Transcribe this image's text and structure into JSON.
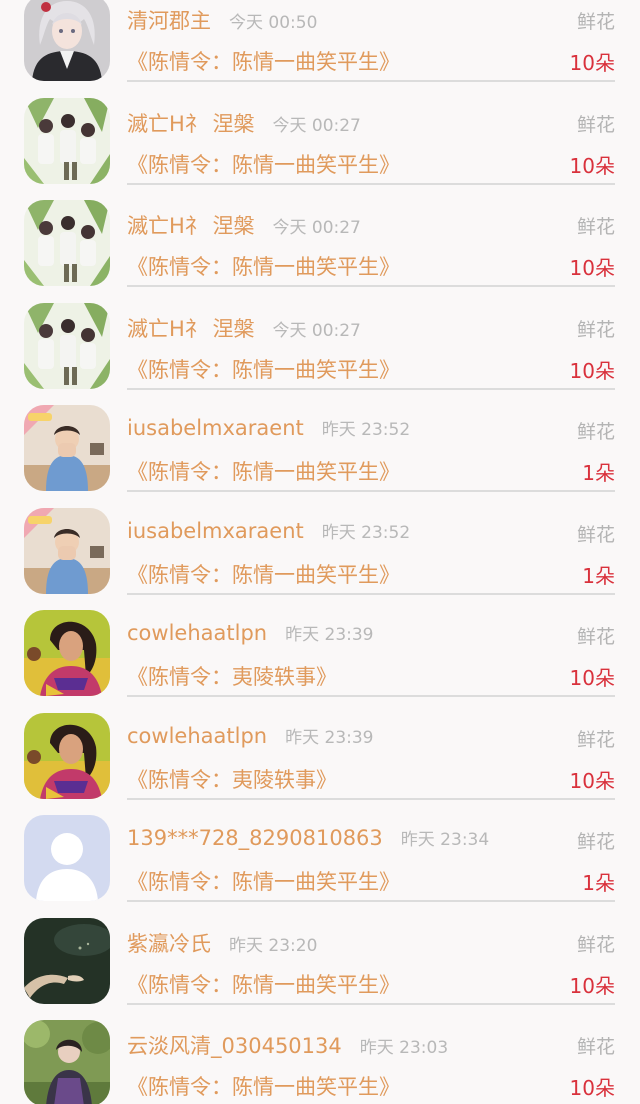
{
  "gift_records": [
    {
      "name": "清河郡主",
      "time": "今天 00:50",
      "gift_type": "鲜花",
      "work": "《陈情令：陈情一曲笑平生》",
      "count": "10朵",
      "avatar": "anime-girl-avatar"
    },
    {
      "name": "滅亡H礻 涅槃",
      "time": "今天 00:27",
      "gift_type": "鲜花",
      "work": "《陈情令：陈情一曲笑平生》",
      "count": "10朵",
      "avatar": "group-photo-avatar"
    },
    {
      "name": "滅亡H礻 涅槃",
      "time": "今天 00:27",
      "gift_type": "鲜花",
      "work": "《陈情令：陈情一曲笑平生》",
      "count": "10朵",
      "avatar": "group-photo-avatar"
    },
    {
      "name": "滅亡H礻 涅槃",
      "time": "今天 00:27",
      "gift_type": "鲜花",
      "work": "《陈情令：陈情一曲笑平生》",
      "count": "10朵",
      "avatar": "group-photo-avatar"
    },
    {
      "name": "iusabelmxaraent",
      "time": "昨天 23:52",
      "gift_type": "鲜花",
      "work": "《陈情令：陈情一曲笑平生》",
      "count": "1朵",
      "avatar": "boy-photo-avatar"
    },
    {
      "name": "iusabelmxaraent",
      "time": "昨天 23:52",
      "gift_type": "鲜花",
      "work": "《陈情令：陈情一曲笑平生》",
      "count": "1朵",
      "avatar": "boy-photo-avatar"
    },
    {
      "name": "cowlehaatlpn",
      "time": "昨天 23:39",
      "gift_type": "鲜花",
      "work": "《陈情令：夷陵轶事》",
      "count": "10朵",
      "avatar": "woman-photo-avatar"
    },
    {
      "name": "cowlehaatlpn",
      "time": "昨天 23:39",
      "gift_type": "鲜花",
      "work": "《陈情令：夷陵轶事》",
      "count": "10朵",
      "avatar": "woman-photo-avatar"
    },
    {
      "name": "139***728_8290810863",
      "time": "昨天 23:34",
      "gift_type": "鲜花",
      "work": "《陈情令：陈情一曲笑平生》",
      "count": "1朵",
      "avatar": "default-user-avatar"
    },
    {
      "name": "紫瀛冷氏",
      "time": "昨天 23:20",
      "gift_type": "鲜花",
      "work": "《陈情令：陈情一曲笑平生》",
      "count": "10朵",
      "avatar": "dark-hand-avatar"
    },
    {
      "name": "云淡风清_030450134",
      "time": "昨天 23:03",
      "gift_type": "鲜花",
      "work": "《陈情令：陈情一曲笑平生》",
      "count": "10朵",
      "avatar": "person-garden-avatar"
    }
  ],
  "colors": {
    "name": "#e09a5c",
    "time": "#b8b8b8",
    "gift_type": "#b4b4b4",
    "count": "#d9313c",
    "divider": "#dcdcdc",
    "background": "#faf8f8"
  }
}
